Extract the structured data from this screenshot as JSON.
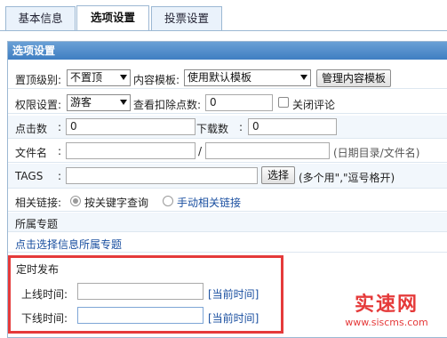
{
  "tabs": [
    {
      "label": "基本信息",
      "active": false
    },
    {
      "label": "选项设置",
      "active": true
    },
    {
      "label": "投票设置",
      "active": false
    }
  ],
  "panel_title": "选项设置",
  "top_level": {
    "label": "置顶级别:",
    "value": "不置顶",
    "template_label": "内容模板:",
    "template_value": "使用默认模板",
    "manage_button": "管理内容模板"
  },
  "permission": {
    "label": "权限设置:",
    "value": "游客",
    "points_label": "查看扣除点数:",
    "points_value": "0",
    "close_comment_label": "关闭评论"
  },
  "counts": {
    "clicks_label": "点击数",
    "clicks_value": "0",
    "downloads_label": "下载数",
    "downloads_value": "0"
  },
  "filename": {
    "label": "文件名",
    "separator": "/",
    "hint": "(日期目录/文件名)"
  },
  "tags": {
    "label": "TAGS",
    "button": "选择",
    "hint": "(多个用\",\"逗号格开)"
  },
  "related": {
    "label": "相关链接:",
    "option_keyword": "按关键字查询",
    "option_manual": "手动相关链接"
  },
  "special": {
    "title": "所属专题",
    "link": "点击选择信息所属专题"
  },
  "schedule": {
    "title": "定时发布",
    "online_label": "上线时间:",
    "online_value": "",
    "online_now": "[当前时间]",
    "offline_label": "下线时间:",
    "offline_value": "",
    "offline_now": "[当前时间]"
  },
  "watermark": {
    "brand": "实速网",
    "url": "www.siscms.com"
  },
  "colors": {
    "accent": "#3f7ec2",
    "highlight_box": "#e53a3a",
    "link": "#1a4fa0"
  }
}
